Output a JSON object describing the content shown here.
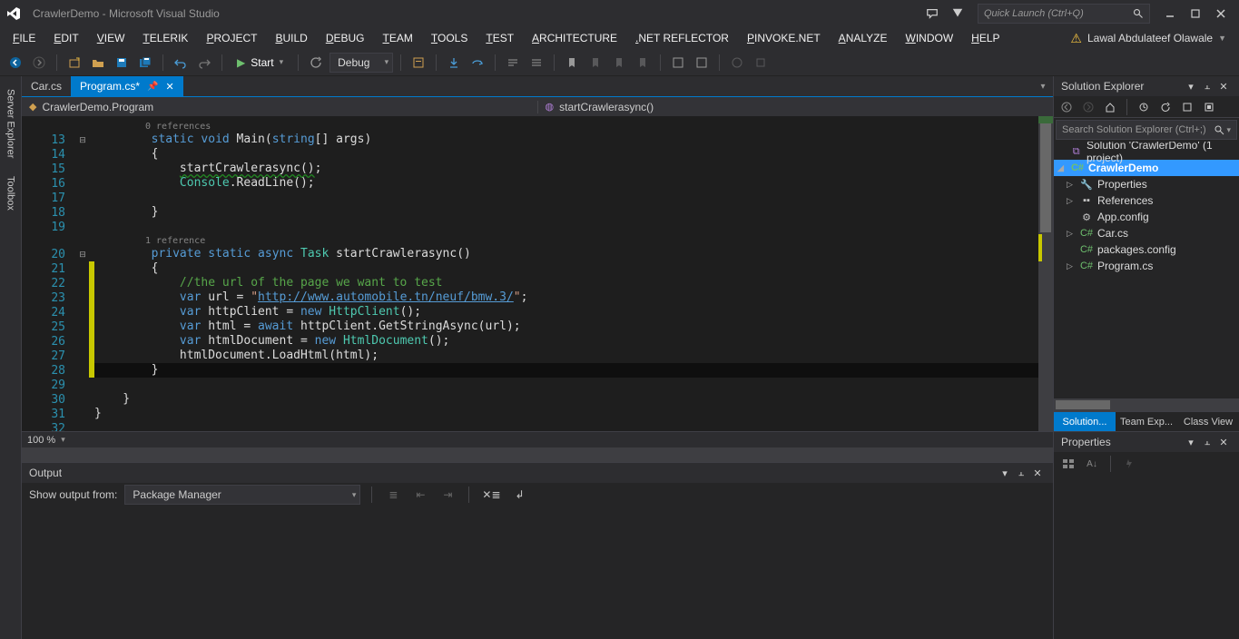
{
  "title_bar": {
    "title": "CrawlerDemo - Microsoft Visual Studio",
    "quick_launch_placeholder": "Quick Launch (Ctrl+Q)"
  },
  "menu": {
    "items": [
      "FILE",
      "EDIT",
      "VIEW",
      "TELERIK",
      "PROJECT",
      "BUILD",
      "DEBUG",
      "TEAM",
      "TOOLS",
      "TEST",
      "ARCHITECTURE",
      ".NET REFLECTOR",
      "PINVOKE.NET",
      "ANALYZE",
      "WINDOW",
      "HELP"
    ],
    "user": "Lawal Abdulateef Olawale"
  },
  "toolbar": {
    "start_label": "Start",
    "config": "Debug"
  },
  "left_wells": {
    "tabs": [
      "Server Explorer",
      "Toolbox"
    ]
  },
  "doc_tabs": {
    "tabs": [
      {
        "label": "Car.cs",
        "active": false,
        "dirty": false
      },
      {
        "label": "Program.cs*",
        "active": true,
        "dirty": true
      }
    ]
  },
  "crumbs": {
    "left": "CrawlerDemo.Program",
    "right": "startCrawlerasync()"
  },
  "editor": {
    "zoom": "100 %",
    "lines": [
      {
        "num": "",
        "type": "codelens",
        "text": "0 references"
      },
      {
        "num": "13",
        "fold": "⊟",
        "text": "        static void Main(string[] args)",
        "tokens": [
          [
            "        ",
            ""
          ],
          [
            "static",
            "k-blue"
          ],
          [
            " ",
            ""
          ],
          [
            "void",
            "k-blue"
          ],
          [
            " Main(",
            ""
          ],
          [
            "string",
            "k-blue"
          ],
          [
            "[] args)",
            ""
          ]
        ]
      },
      {
        "num": "14",
        "text": "        {",
        "tokens": [
          [
            "        {",
            ""
          ]
        ]
      },
      {
        "num": "15",
        "text": "            startCrawlerasync();",
        "tokens": [
          [
            "            ",
            ""
          ],
          [
            "startCrawlerasync()",
            "k-under"
          ],
          [
            ";",
            ""
          ]
        ]
      },
      {
        "num": "16",
        "text": "            Console.ReadLine();",
        "tokens": [
          [
            "            ",
            ""
          ],
          [
            "Console",
            "k-type"
          ],
          [
            ".ReadLine();",
            ""
          ]
        ]
      },
      {
        "num": "17",
        "text": "",
        "tokens": [
          [
            "",
            ""
          ]
        ]
      },
      {
        "num": "18",
        "text": "        }",
        "tokens": [
          [
            "        }",
            ""
          ]
        ]
      },
      {
        "num": "19",
        "text": "",
        "tokens": [
          [
            "",
            ""
          ]
        ]
      },
      {
        "num": "",
        "type": "codelens",
        "text": "1 reference"
      },
      {
        "num": "20",
        "fold": "⊟",
        "text": "        private static async Task startCrawlerasync()",
        "tokens": [
          [
            "        ",
            ""
          ],
          [
            "private",
            "k-blue"
          ],
          [
            " ",
            ""
          ],
          [
            "static",
            "k-blue"
          ],
          [
            " ",
            ""
          ],
          [
            "async",
            "k-blue"
          ],
          [
            " ",
            ""
          ],
          [
            "Task",
            "k-type"
          ],
          [
            " startCrawlerasync()",
            ""
          ]
        ]
      },
      {
        "num": "21",
        "mark": true,
        "text": "        {",
        "tokens": [
          [
            "        ",
            ""
          ],
          [
            "{",
            "k-meth"
          ]
        ]
      },
      {
        "num": "22",
        "mark": true,
        "text": "            //the url of the page we want to test",
        "tokens": [
          [
            "            ",
            ""
          ],
          [
            "//the url of the page we want to test",
            "k-com"
          ]
        ]
      },
      {
        "num": "23",
        "mark": true,
        "text": "",
        "tokens": [
          [
            "            ",
            ""
          ],
          [
            "var",
            "k-blue"
          ],
          [
            " url = ",
            ""
          ],
          [
            "\"",
            "k-str"
          ],
          [
            "http://www.automobile.tn/neuf/bmw.3/",
            "k-url"
          ],
          [
            "\"",
            "k-str"
          ],
          [
            ";",
            ""
          ]
        ]
      },
      {
        "num": "24",
        "mark": true,
        "text": "",
        "tokens": [
          [
            "            ",
            ""
          ],
          [
            "var",
            "k-blue"
          ],
          [
            " httpClient = ",
            ""
          ],
          [
            "new",
            "k-blue"
          ],
          [
            " ",
            ""
          ],
          [
            "HttpClient",
            "k-type"
          ],
          [
            "();",
            ""
          ]
        ]
      },
      {
        "num": "25",
        "mark": true,
        "text": "",
        "tokens": [
          [
            "            ",
            ""
          ],
          [
            "var",
            "k-blue"
          ],
          [
            " html = ",
            ""
          ],
          [
            "await",
            "k-blue"
          ],
          [
            " httpClient.GetStringAsync(url);",
            ""
          ]
        ]
      },
      {
        "num": "26",
        "mark": true,
        "text": "",
        "tokens": [
          [
            "            ",
            ""
          ],
          [
            "var",
            "k-blue"
          ],
          [
            " htmlDocument = ",
            ""
          ],
          [
            "new",
            "k-blue"
          ],
          [
            " ",
            ""
          ],
          [
            "HtmlDocument",
            "k-type"
          ],
          [
            "();",
            ""
          ]
        ]
      },
      {
        "num": "27",
        "mark": true,
        "text": "",
        "tokens": [
          [
            "            htmlDocument.LoadHtml(html);",
            ""
          ]
        ]
      },
      {
        "num": "28",
        "mark": true,
        "active": true,
        "text": "        }",
        "tokens": [
          [
            "        ",
            ""
          ],
          [
            "}",
            ""
          ]
        ]
      },
      {
        "num": "29",
        "text": "",
        "tokens": [
          [
            "",
            ""
          ]
        ]
      },
      {
        "num": "30",
        "text": "    }",
        "tokens": [
          [
            "    }",
            ""
          ]
        ]
      },
      {
        "num": "31",
        "fold": "",
        "text": "}",
        "tokens": [
          [
            "}",
            ""
          ]
        ]
      },
      {
        "num": "32",
        "text": "",
        "tokens": [
          [
            "",
            ""
          ]
        ]
      }
    ]
  },
  "output": {
    "title": "Output",
    "show_label": "Show output from:",
    "source": "Package Manager"
  },
  "solution_explorer": {
    "title": "Solution Explorer",
    "search_placeholder": "Search Solution Explorer (Ctrl+;)",
    "tabs": [
      "Solution...",
      "Team Exp...",
      "Class View"
    ],
    "tree": [
      {
        "level": 0,
        "arrow": "",
        "icon": "⧉",
        "iconcls": "ic-sln",
        "label": "Solution 'CrawlerDemo' (1 project)"
      },
      {
        "level": 0,
        "arrow": "◢",
        "icon": "C#",
        "iconcls": "ic-cs",
        "label": "CrawlerDemo",
        "selected": true,
        "bold": true
      },
      {
        "level": 1,
        "arrow": "▷",
        "icon": "🔧",
        "iconcls": "ic-prop",
        "label": "Properties"
      },
      {
        "level": 1,
        "arrow": "▷",
        "icon": "▪▪",
        "iconcls": "ic-ref",
        "label": "References"
      },
      {
        "level": 1,
        "arrow": "",
        "icon": "⚙",
        "iconcls": "ic-cfg",
        "label": "App.config"
      },
      {
        "level": 1,
        "arrow": "▷",
        "icon": "C#",
        "iconcls": "ic-cs",
        "label": "Car.cs"
      },
      {
        "level": 1,
        "arrow": "",
        "icon": "C#",
        "iconcls": "ic-cs",
        "label": "packages.config"
      },
      {
        "level": 1,
        "arrow": "▷",
        "icon": "C#",
        "iconcls": "ic-cs",
        "label": "Program.cs"
      }
    ]
  },
  "properties": {
    "title": "Properties"
  }
}
